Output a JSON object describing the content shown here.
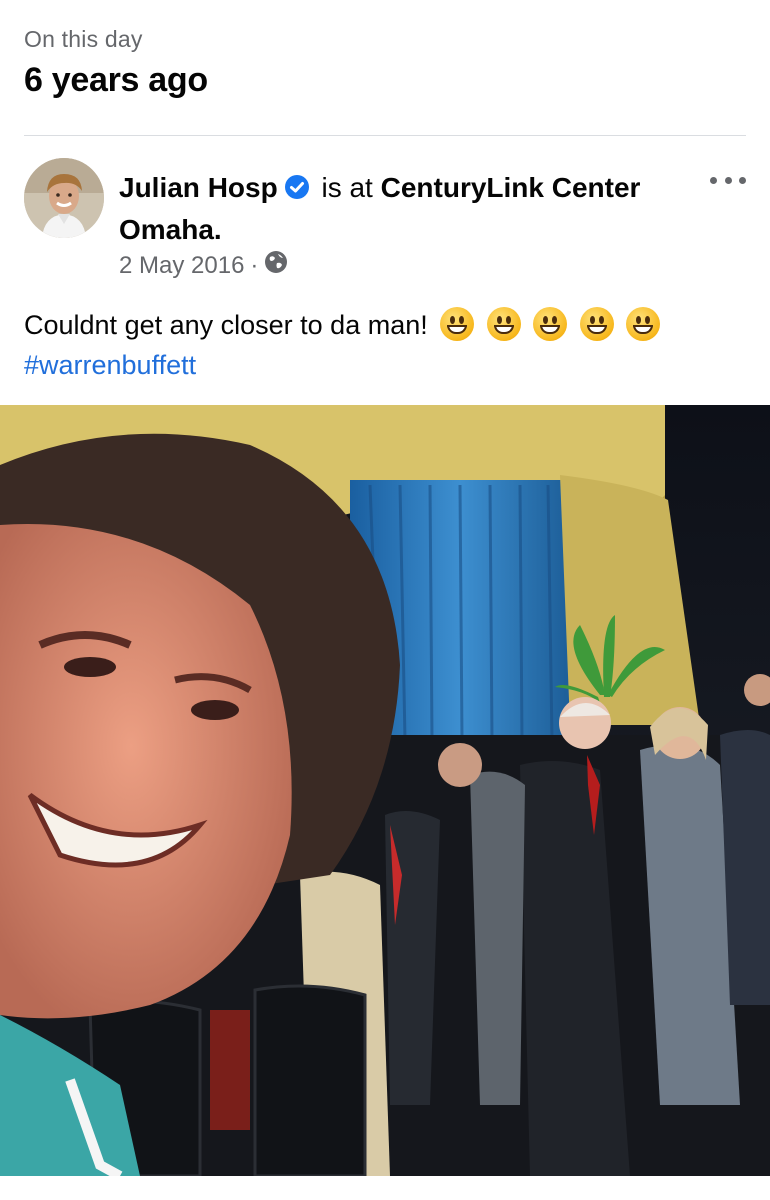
{
  "memory": {
    "kicker": "On this day",
    "title": "6 years ago"
  },
  "post": {
    "author": "Julian Hosp",
    "verified_icon": "verified-badge-icon",
    "location_prefix": " is at ",
    "location": "CenturyLink Center Omaha.",
    "date": "2 May 2016",
    "separator": "·",
    "audience_icon": "globe-icon",
    "more_icon": "more-options-icon",
    "text": "Couldnt get any closer to da man!",
    "emoji_name": "grinning-face-emoji",
    "emoji_count": 5,
    "hashtag": "#warrenbuffett"
  },
  "colors": {
    "link": "#216fdb",
    "secondary_text": "#65676b",
    "verified": "#1877f2"
  }
}
